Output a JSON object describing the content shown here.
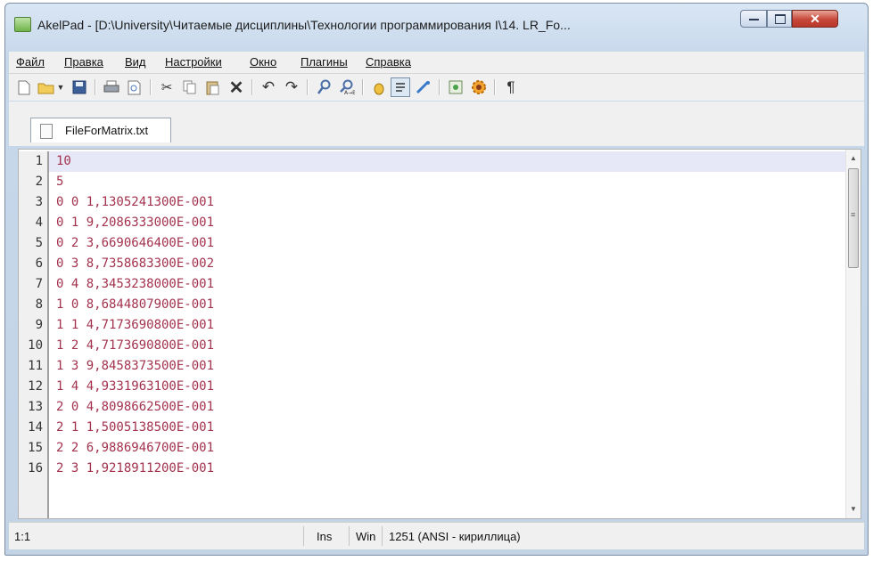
{
  "window": {
    "title": "AkelPad - [D:\\University\\Читаемые дисциплины\\Технологии программирования I\\14. LR_Fo..."
  },
  "menu": [
    "Файл",
    "Правка",
    "Вид",
    "Настройки",
    "Окно",
    "Плагины",
    "Справка"
  ],
  "toolbar": {
    "icons": [
      "new-file-icon",
      "open-folder-icon",
      "dropdown-arrow-icon",
      "save-icon",
      "print-icon",
      "print-preview-icon",
      "cut-icon",
      "copy-icon",
      "paste-icon",
      "delete-icon",
      "undo-icon",
      "redo-icon",
      "find-icon",
      "replace-icon",
      "insert-char-icon",
      "word-wrap-icon",
      "color-icon",
      "edit-icon",
      "settings-icon",
      "pilcrow-icon"
    ]
  },
  "tab": {
    "label": "FileForMatrix.txt"
  },
  "editor": {
    "lines": [
      {
        "num": "1",
        "text": "10"
      },
      {
        "num": "2",
        "text": "5"
      },
      {
        "num": "3",
        "text": "0 0 1,1305241300E-001"
      },
      {
        "num": "4",
        "text": "0 1 9,2086333000E-001"
      },
      {
        "num": "5",
        "text": "0 2 3,6690646400E-001"
      },
      {
        "num": "6",
        "text": "0 3 8,7358683300E-002"
      },
      {
        "num": "7",
        "text": "0 4 8,3453238000E-001"
      },
      {
        "num": "8",
        "text": "1 0 8,6844807900E-001"
      },
      {
        "num": "9",
        "text": "1 1 4,7173690800E-001"
      },
      {
        "num": "10",
        "text": "1 2 4,7173690800E-001"
      },
      {
        "num": "11",
        "text": "1 3 9,8458373500E-001"
      },
      {
        "num": "12",
        "text": "1 4 4,9331963100E-001"
      },
      {
        "num": "13",
        "text": "2 0 4,8098662500E-001"
      },
      {
        "num": "14",
        "text": "2 1 1,5005138500E-001"
      },
      {
        "num": "15",
        "text": "2 2 6,9886946700E-001"
      },
      {
        "num": "16",
        "text": "2 3 1,9218911200E-001"
      }
    ]
  },
  "status": {
    "position": "1:1",
    "insert_mode": "Ins",
    "newline": "Win",
    "encoding": "1251  (ANSI - кириллица)"
  }
}
